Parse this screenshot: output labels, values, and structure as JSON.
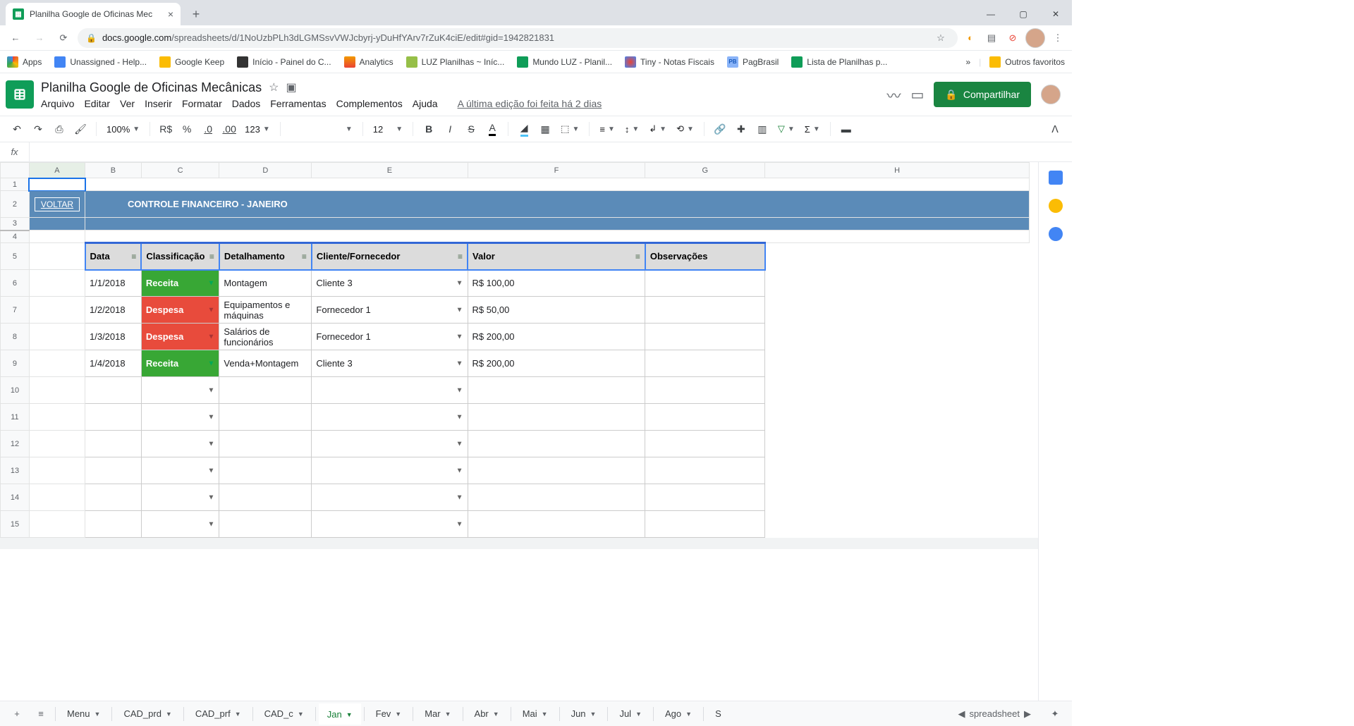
{
  "browser": {
    "tab_title": "Planilha Google de Oficinas Mec",
    "url_host": "docs.google.com",
    "url_path": "/spreadsheets/d/1NoUzbPLh3dLGMSsvVWJcbyrj-yDuHfYArv7rZuK4ciE/edit#gid=1942821831",
    "other_fav": "Outros favoritos",
    "bookmarks": [
      {
        "label": "Apps"
      },
      {
        "label": "Unassigned - Help..."
      },
      {
        "label": "Google Keep"
      },
      {
        "label": "Início - Painel do C..."
      },
      {
        "label": "Analytics"
      },
      {
        "label": "LUZ Planilhas ~ Iníc..."
      },
      {
        "label": "Mundo LUZ - Planil..."
      },
      {
        "label": "Tiny - Notas Fiscais"
      },
      {
        "label": "PagBrasil"
      },
      {
        "label": "Lista de Planilhas p..."
      }
    ]
  },
  "doc": {
    "title": "Planilha Google de Oficinas Mecânicas",
    "menus": [
      "Arquivo",
      "Editar",
      "Ver",
      "Inserir",
      "Formatar",
      "Dados",
      "Ferramentas",
      "Complementos",
      "Ajuda"
    ],
    "last_edit": "A última edição foi feita há 2 dias",
    "share": "Compartilhar"
  },
  "toolbar": {
    "zoom": "100%",
    "currency": "R$",
    "percent": "%",
    "dec_dec": ".0",
    "dec_inc": ".00",
    "fmt": "123",
    "font_size": "12"
  },
  "fx": {
    "label": "fx"
  },
  "sheet": {
    "cols": [
      "A",
      "B",
      "C",
      "D",
      "E",
      "F",
      "G",
      "H"
    ],
    "rows": [
      "1",
      "2",
      "3",
      "4",
      "5",
      "6",
      "7",
      "8",
      "9",
      "10",
      "11",
      "12",
      "13",
      "14",
      "15"
    ],
    "back_link": "VOLTAR",
    "banner": "CONTROLE FINANCEIRO - JANEIRO",
    "headers": [
      "Data",
      "Classificação",
      "Detalhamento",
      "Cliente/Fornecedor",
      "Valor",
      "Observações"
    ],
    "data": [
      {
        "data": "1/1/2018",
        "class": "Receita",
        "class_color": "green",
        "det": "Montagem",
        "cli": "Cliente 3",
        "val": "R$ 100,00",
        "obs": ""
      },
      {
        "data": "1/2/2018",
        "class": "Despesa",
        "class_color": "red",
        "det": "Equipamentos e máquinas",
        "cli": "Fornecedor 1",
        "val": "R$ 50,00",
        "obs": ""
      },
      {
        "data": "1/3/2018",
        "class": "Despesa",
        "class_color": "red",
        "det": "Salários de funcionários",
        "cli": "Fornecedor 1",
        "val": "R$ 200,00",
        "obs": ""
      },
      {
        "data": "1/4/2018",
        "class": "Receita",
        "class_color": "green",
        "det": "Venda+Montagem",
        "cli": "Cliente 3",
        "val": "R$ 200,00",
        "obs": ""
      }
    ]
  },
  "tabs": {
    "list": [
      "Menu",
      "CAD_prd",
      "CAD_prf",
      "CAD_c",
      "Jan",
      "Fev",
      "Mar",
      "Abr",
      "Mai",
      "Jun",
      "Jul",
      "Ago"
    ],
    "active": "Jan",
    "trail": "S"
  }
}
